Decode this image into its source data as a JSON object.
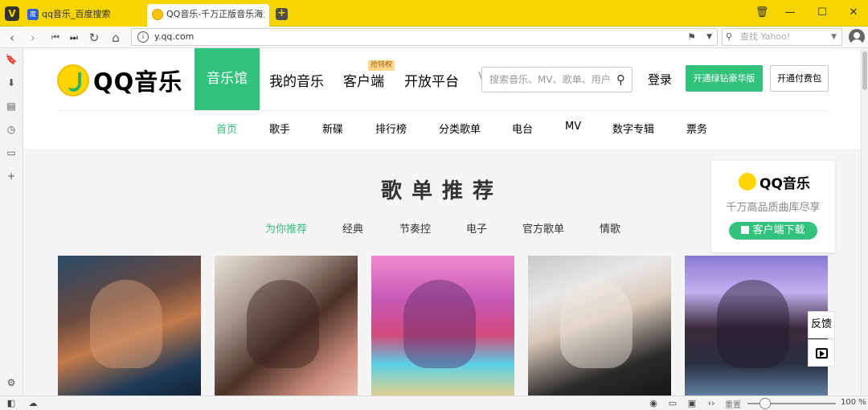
{
  "tabs": [
    {
      "title": "qq音乐_百度搜索"
    },
    {
      "title": "QQ音乐-千万正版音乐海量无损曲库"
    }
  ],
  "toolbar": {
    "url": "y.qq.com",
    "search_placeholder": "查找 Yahoo!"
  },
  "site": {
    "logo_text": "QQ音乐",
    "nav": [
      "音乐馆",
      "我的音乐",
      "客户端",
      "开放平台",
      "V"
    ],
    "nav_badge": "抢特权",
    "search_placeholder": "搜索音乐、MV、歌单、用户",
    "login": "登录",
    "vip_button": "开通绿钻豪华版",
    "paid_button": "开通付费包",
    "subnav": [
      "首页",
      "歌手",
      "新碟",
      "排行榜",
      "分类歌单",
      "电台",
      "MV",
      "数字专辑",
      "票务"
    ]
  },
  "section": {
    "title": "歌单推荐",
    "categories": [
      "为你推荐",
      "经典",
      "节奏控",
      "电子",
      "官方歌单",
      "情歌"
    ]
  },
  "promo": {
    "title": "QQ音乐",
    "subtitle": "千万高品质曲库尽享",
    "download": "客户端下载"
  },
  "float": {
    "feedback": "反馈"
  },
  "statusbar": {
    "reset": "重置",
    "zoom": "100 %"
  },
  "colors": {
    "brand_green": "#31c27c",
    "browser_yellow": "#f6d400"
  }
}
